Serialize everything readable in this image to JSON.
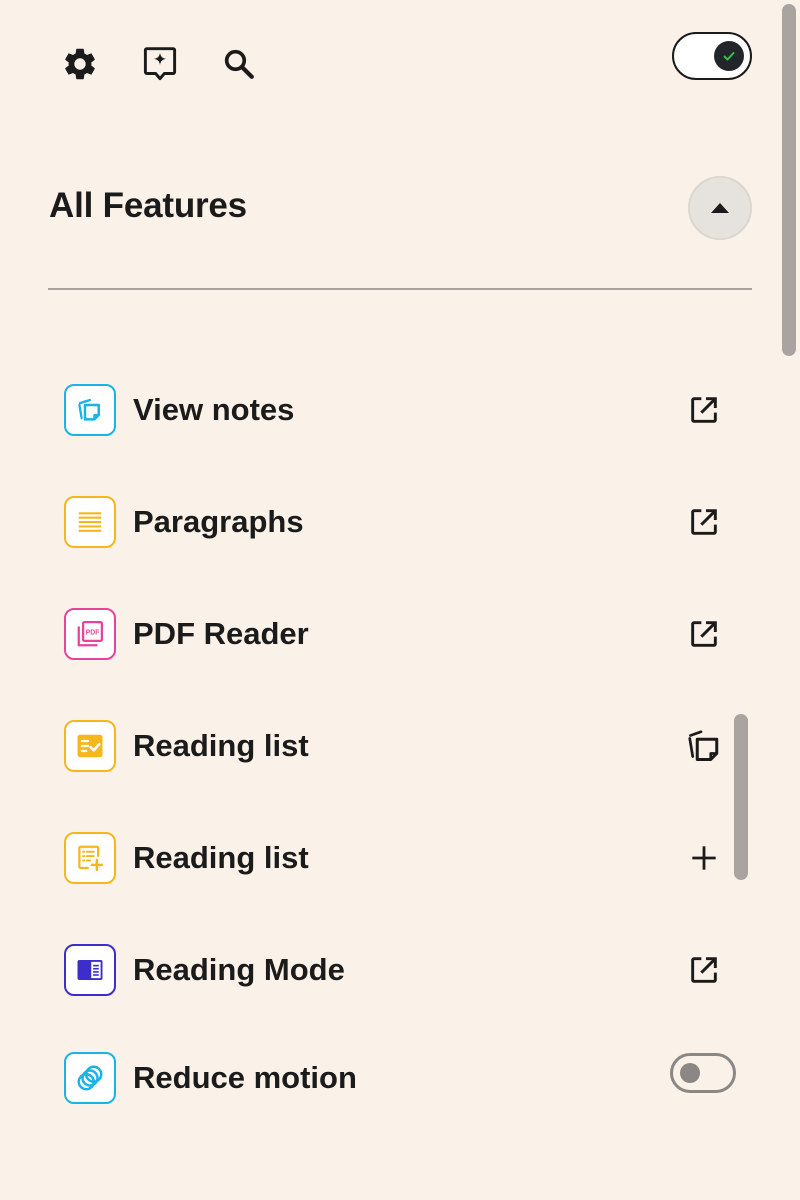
{
  "toolbar": {
    "settings_icon": "gear-icon",
    "assistant_icon": "sparkle-badge-icon",
    "search_icon": "search-icon",
    "master_toggle_state": "on"
  },
  "section": {
    "title": "All Features",
    "collapse_icon": "caret-up-icon"
  },
  "features": [
    {
      "label": "View notes",
      "icon": "notes-icon",
      "color": "#1ab3e6",
      "action": "external-link-icon"
    },
    {
      "label": "Paragraphs",
      "icon": "paragraphs-icon",
      "color": "#f5b81c",
      "action": "external-link-icon"
    },
    {
      "label": "PDF Reader",
      "icon": "pdf-icon",
      "color": "#e8439b",
      "action": "external-link-icon"
    },
    {
      "label": "Reading list",
      "icon": "reading-list-check-icon",
      "color": "#f5b81c",
      "action": "copy-icon"
    },
    {
      "label": "Reading list",
      "icon": "reading-list-add-icon",
      "color": "#f5b81c",
      "action": "plus-icon"
    },
    {
      "label": "Reading Mode",
      "icon": "reading-mode-icon",
      "color": "#3d2ecc",
      "action": "external-link-icon"
    },
    {
      "label": "Reduce motion",
      "icon": "reduce-motion-icon",
      "color": "#1ab3e6",
      "action": "toggle",
      "toggle_state": "off"
    }
  ],
  "icon_glyphs": {
    "pdf_text": "PDF"
  }
}
